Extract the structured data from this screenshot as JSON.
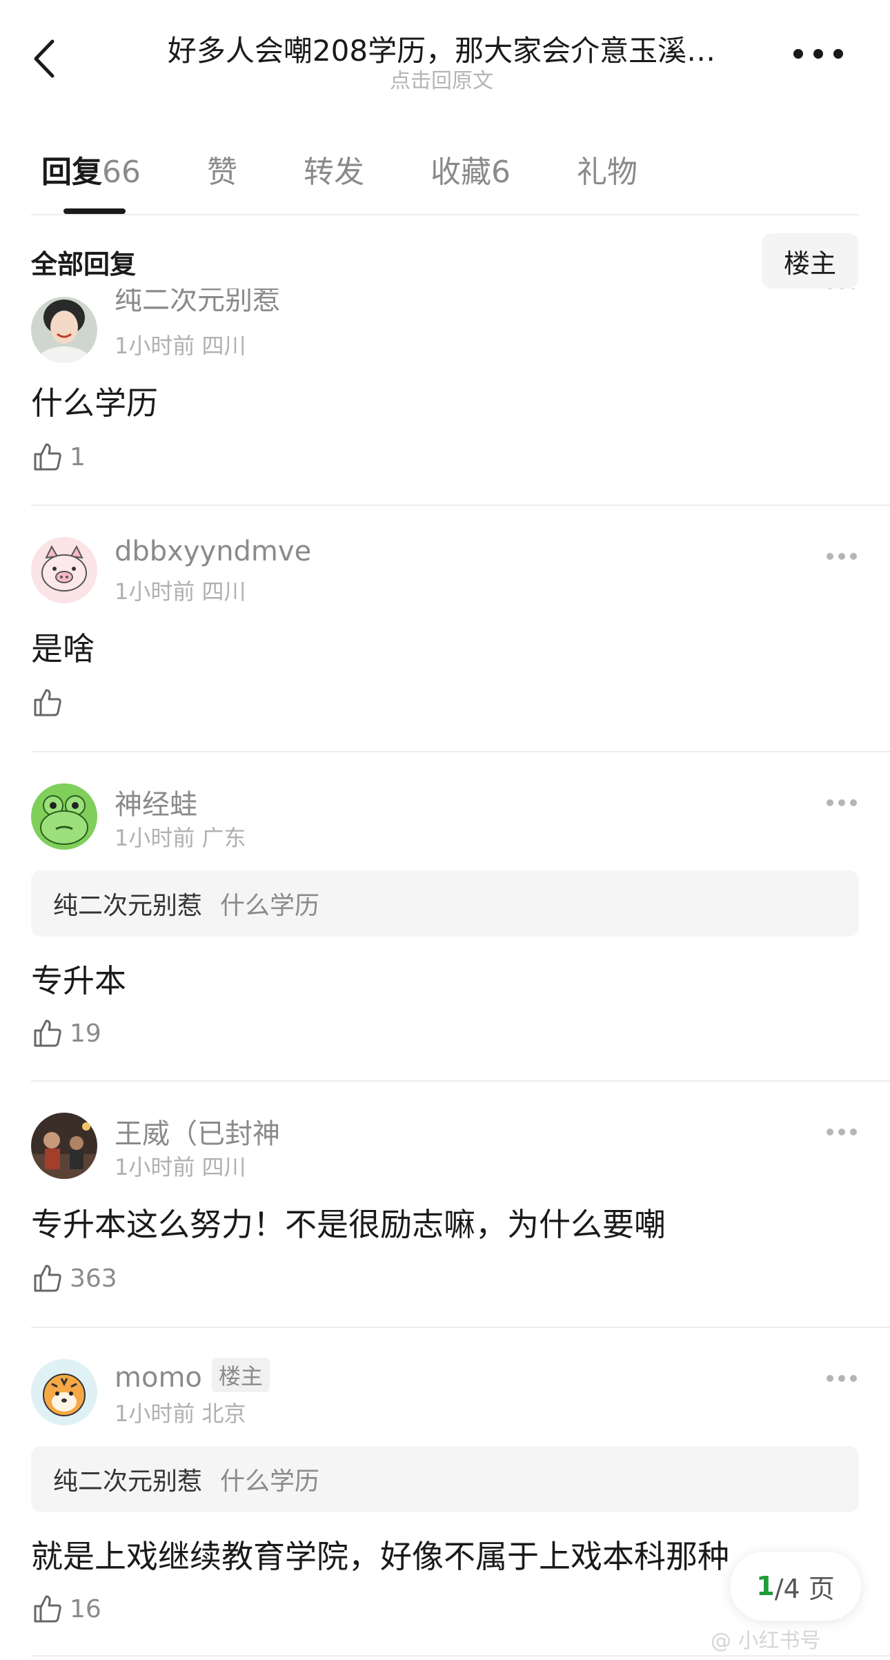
{
  "header": {
    "title": "好多人会嘲208学历，那大家会介意玉溪…",
    "subtitle": "点击回原文"
  },
  "tabs": [
    {
      "label": "回复",
      "count": "66"
    },
    {
      "label": "赞",
      "count": ""
    },
    {
      "label": "转发",
      "count": ""
    },
    {
      "label": "收藏",
      "count": "6"
    },
    {
      "label": "礼物",
      "count": ""
    }
  ],
  "section": {
    "title": "全部回复",
    "filter_label": "楼主"
  },
  "comments": [
    {
      "username": "纯二次元别惹",
      "time": "1小时前",
      "location": "四川",
      "text": "什么学历",
      "likes": "1",
      "avatar": "woman-photo-avatar"
    },
    {
      "username": "dbbxyyndmve",
      "time": "1小时前",
      "location": "四川",
      "text": "是啥",
      "likes": "",
      "avatar": "pig-cartoon-avatar"
    },
    {
      "username": "神经蛙",
      "time": "1小时前",
      "location": "广东",
      "quote_user": "纯二次元别惹",
      "quote_text": "什么学历",
      "text": "专升本",
      "likes": "19",
      "avatar": "frog-cartoon-avatar"
    },
    {
      "username": "王威（已封神",
      "time": "1小时前",
      "location": "四川",
      "text": "专升本这么努力！不是很励志嘛，为什么要嘲",
      "likes": "363",
      "avatar": "scene-photo-avatar"
    },
    {
      "username": "momo",
      "op_tag": "楼主",
      "time": "1小时前",
      "location": "北京",
      "quote_user": "纯二次元别惹",
      "quote_text": "什么学历",
      "text": "就是上戏继续教育学院，好像不属于上戏本科那种",
      "likes": "16",
      "avatar": "tiger-cartoon-avatar"
    }
  ],
  "pager": {
    "current": "1",
    "total_label": "/4 页"
  },
  "watermark": "@ 小红书号"
}
